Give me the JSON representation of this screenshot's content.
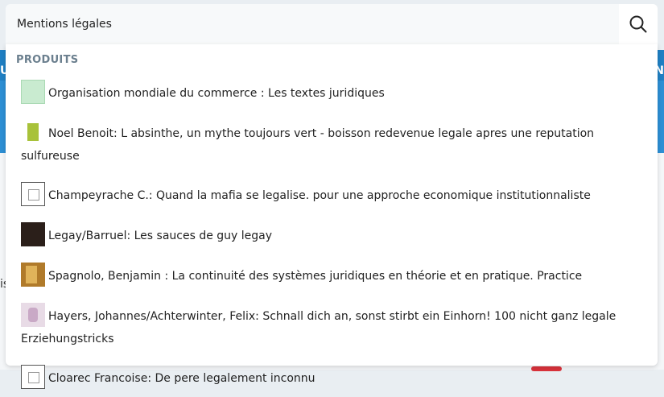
{
  "search": {
    "value": "Mentions légales",
    "button_icon": "search-icon"
  },
  "background": {
    "left_fragment": "UT",
    "right_fragment": "EN",
    "side_fragment": "is"
  },
  "dropdown": {
    "section_title": "PRODUITS",
    "results": [
      {
        "label": "Organisation mondiale du commerce : Les textes juridiques",
        "thumb": "green-cover"
      },
      {
        "label": "Noel Benoit: L absinthe, un mythe toujours vert - boisson redevenue legale apres une reputation sulfureuse",
        "thumb": "lime-cover"
      },
      {
        "label": "Champeyrache C.: Quand la mafia se legalise. pour une approche economique institutionnaliste",
        "thumb": "placeholder"
      },
      {
        "label": "Legay/Barruel: Les sauces de guy legay",
        "thumb": "dark-cover"
      },
      {
        "label": "Spagnolo, Benjamin : La continuité des systèmes juridiques en théorie et en pratique. Practice",
        "thumb": "orange-cover"
      },
      {
        "label": "Hayers, Johannes/Achterwinter, Felix: Schnall dich an, sonst stirbt ein Einhorn! 100 nicht ganz legale Erziehungstricks",
        "thumb": "pink-cover"
      },
      {
        "label": "Cloarec Francoise: De pere legalement inconnu",
        "thumb": "placeholder"
      }
    ]
  }
}
